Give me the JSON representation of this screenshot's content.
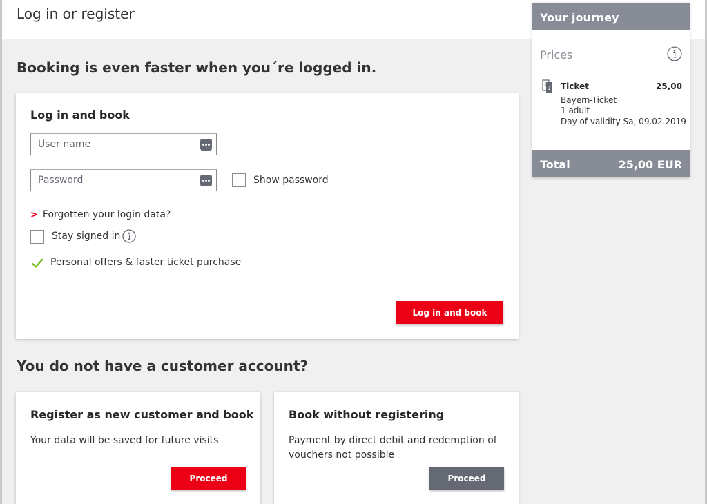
{
  "header": {
    "title": "Log in or register"
  },
  "intro": {
    "heading": "Booking is even faster when you´re logged in."
  },
  "login": {
    "title": "Log in and book",
    "username_placeholder": "User name",
    "password_placeholder": "Password",
    "show_password_label": "Show password",
    "forgot_link": "Forgotten your login data?",
    "stay_signed_in_label": "Stay signed in",
    "perk_text": "Personal offers & faster ticket purchase",
    "submit_label": "Log in and book"
  },
  "no_account": {
    "heading": "You do not have a customer account?",
    "register": {
      "title": "Register as new customer and book",
      "description": "Your data will be saved for future visits",
      "button_label": "Proceed"
    },
    "guest": {
      "title": "Book without registering",
      "description": "Payment by direct debit and redemption of vouchers not possible",
      "button_label": "Proceed"
    }
  },
  "journey": {
    "title": "Your journey",
    "prices_label": "Prices",
    "ticket": {
      "label": "Ticket",
      "price": "25,00",
      "name": "Bayern-Ticket",
      "passengers": "1 adult",
      "validity": "Day of validity Sa, 09.02.2019"
    },
    "total_label": "Total",
    "total_amount": "25,00 EUR"
  },
  "colors": {
    "accent_red": "#ec0016",
    "grey_button": "#646973",
    "panel_grey": "#878c96",
    "check_green": "#78be20"
  },
  "icons": {
    "field_icon": "password-manager-dots-icon",
    "info_icon": "info-icon",
    "check_icon": "checkmark-icon",
    "ticket_icon": "ticket-icon",
    "link_icon": "chevron-right-icon"
  }
}
